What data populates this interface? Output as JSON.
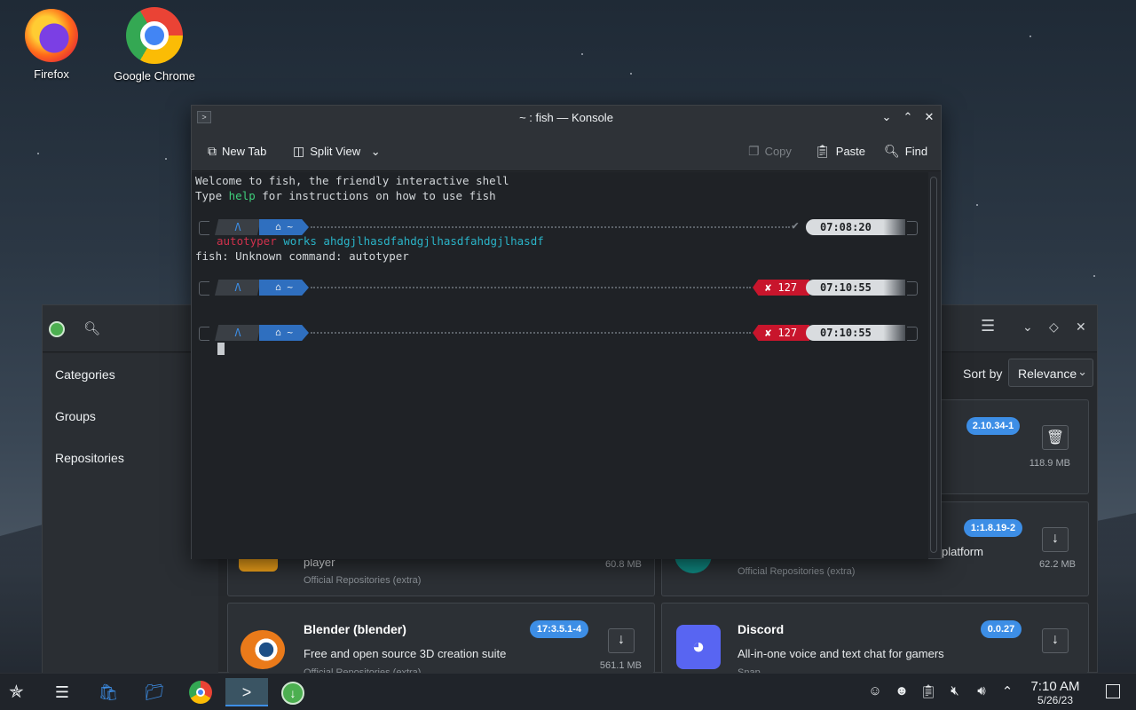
{
  "desktop": {
    "icons": [
      {
        "label": "Firefox"
      },
      {
        "label": "Google Chrome"
      }
    ]
  },
  "discover": {
    "sidebar": [
      "Categories",
      "Groups",
      "Repositories"
    ],
    "sort_label": "Sort by",
    "sort_value": "Relevance",
    "cards": [
      {
        "version": "2.10.34-1",
        "size": "118.9 MB",
        "action": "remove"
      },
      {
        "title": "",
        "desc": "player",
        "source": "Official Repositories (extra)",
        "size": "60.8 MB"
      },
      {
        "version": "1:1.8.19-2",
        "desc": "platform",
        "source": "Official Repositories (extra)",
        "size": "62.2 MB"
      },
      {
        "title": "Blender (blender)",
        "desc": "Free and open source 3D creation suite",
        "source": "Official Repositories (extra)",
        "version": "17:3.5.1-4",
        "size": "561.1 MB"
      },
      {
        "title": "Discord",
        "desc": "All-in-one voice and text chat for gamers",
        "source": "Snap",
        "version": "0.0.27"
      }
    ]
  },
  "konsole": {
    "title": "~ : fish — Konsole",
    "toolbar": {
      "new_tab": "New Tab",
      "split_view": "Split View",
      "copy": "Copy",
      "paste": "Paste",
      "find": "Find"
    },
    "terminal": {
      "welcome_1": "Welcome to fish, the friendly interactive shell",
      "welcome_2a": "Type ",
      "welcome_2b": "help",
      "welcome_2c": " for instructions on how to use fish",
      "cmd_word": "autotyper",
      "cmd_args": " works ahdgjlhasdfahdgjlhasdfahdgjlhasdf",
      "error_line": "fish: Unknown command: autotyper",
      "prompts": [
        {
          "dir": "~",
          "status": "✔",
          "time": "07:08:20"
        },
        {
          "dir": "~",
          "status": "✘ 127",
          "time": "07:10:55"
        },
        {
          "dir": "~",
          "status": "✘ 127",
          "time": "07:10:55"
        }
      ]
    }
  },
  "taskbar": {
    "time": "7:10 AM",
    "date": "5/26/23"
  }
}
